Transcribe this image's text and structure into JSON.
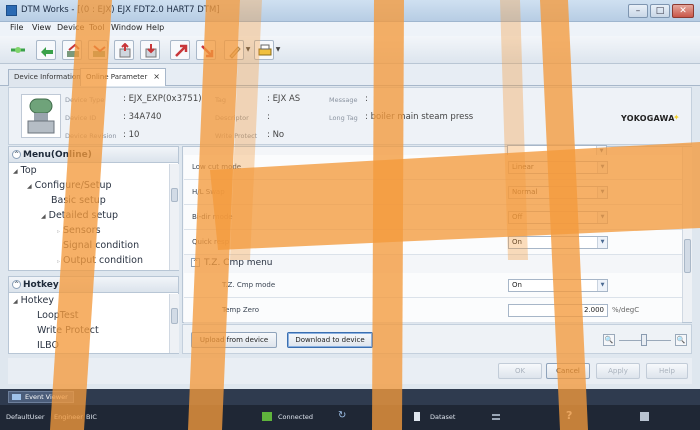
{
  "window": {
    "title": "DTM Works - [(0 : EJX) EJX FDT2.0 HART7 DTM]",
    "min_glyph": "–",
    "max_glyph": "□",
    "close_glyph": "✕"
  },
  "menubar": [
    "File",
    "View",
    "Device",
    "Tool",
    "Window",
    "Help"
  ],
  "tabs": [
    {
      "label": "Device Information"
    },
    {
      "label": "Online Parameter",
      "close": "×"
    }
  ],
  "device": {
    "type_label": "Device Type",
    "type_value": ": EJX_EXP(0x3751)",
    "id_label": "Device ID",
    "id_value": ": 34A740",
    "rev_label": "Device Revision",
    "rev_value": ": 10",
    "tag_label": "Tag",
    "tag_value": ": EJX AS",
    "desc_label": "Descriptor",
    "desc_value": ":",
    "wp_label": "Write Protect",
    "wp_value": ": No",
    "msg_label": "Message",
    "msg_value": ":",
    "longtag_label": "Long Tag",
    "longtag_value": ": boiler main steam press",
    "vendor": "YOKOGAWA"
  },
  "menu_online": {
    "title": "Menu(Online)",
    "items": [
      "Top",
      "Configure/Setup",
      "Basic setup",
      "Detailed setup",
      "Sensors",
      "Signal condition",
      "Output condition"
    ]
  },
  "hotkey": {
    "title": "Hotkey",
    "items": [
      "Hotkey",
      "LoopTest",
      "Write Protect",
      "ILBO"
    ]
  },
  "params": {
    "low_cut_mode": {
      "label": "Low cut mode",
      "value": "Linear"
    },
    "hl_swap": {
      "label": "H/L Swap",
      "value": "Normal"
    },
    "bidir_mode": {
      "label": "Bi-dir mode",
      "value": "Off"
    },
    "quick_resp": {
      "label": "Quick resp",
      "value": "On"
    },
    "tz_section": "T.Z. Cmp menu",
    "tz_cmp_mode": {
      "label": "T.Z. Cmp mode",
      "value": "On"
    },
    "temp_zero": {
      "label": "Temp Zero",
      "value": "2.000",
      "unit": "%/degC"
    }
  },
  "buttons": {
    "upload": "Upload from device",
    "download": "Download to device",
    "ok": "OK",
    "cancel": "Cancel",
    "apply": "Apply",
    "help": "Help"
  },
  "event_viewer": "Event Viewer",
  "status": {
    "user": "DefaultUser",
    "role": "Engineer",
    "bic": "BIC",
    "connected": "Connected",
    "dataset": "Dataset"
  },
  "colors": {
    "watermark_orange": "#f39a3c",
    "status_bg": "#1f2735"
  }
}
